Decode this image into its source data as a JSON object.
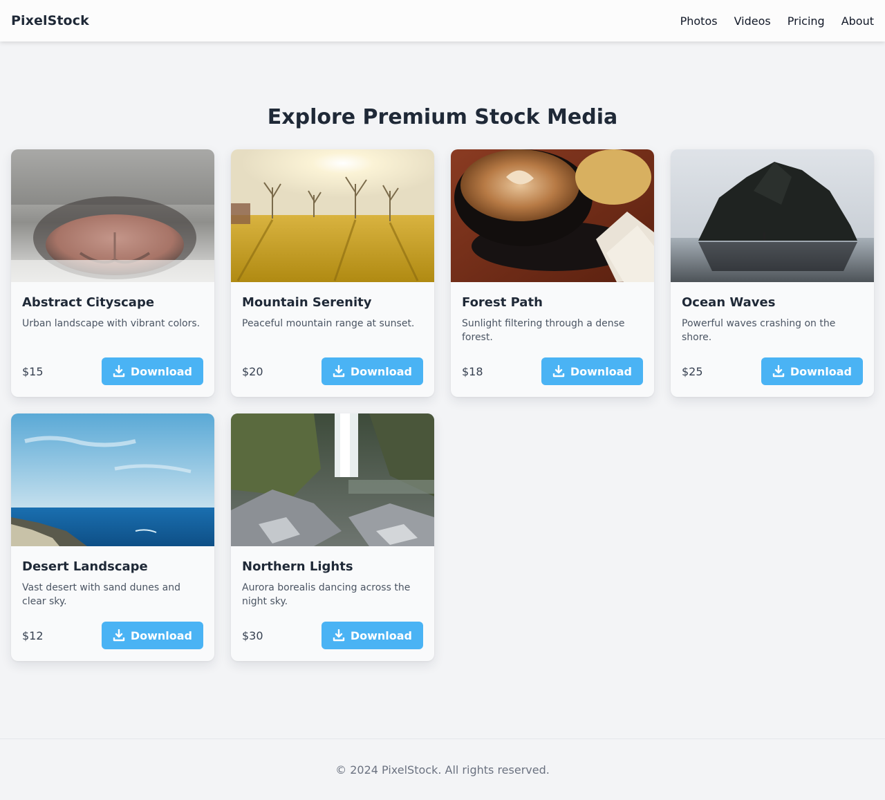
{
  "brand": {
    "name": "PixelStock"
  },
  "nav": {
    "links": [
      "Photos",
      "Videos",
      "Pricing",
      "About"
    ]
  },
  "hero": {
    "title": "Explore Premium Stock Media"
  },
  "colors": {
    "accent": "#4ab3f4",
    "background": "#f3f4f6",
    "heading": "#1f2937"
  },
  "cards": [
    {
      "title": "Abstract Cityscape",
      "desc": "Urban landscape with vibrant colors.",
      "price": "$15",
      "button": "Download",
      "image": "cat-nose-closeup"
    },
    {
      "title": "Mountain Serenity",
      "desc": "Peaceful mountain range at sunset.",
      "price": "$20",
      "button": "Download",
      "image": "sunlit-field-trees"
    },
    {
      "title": "Forest Path",
      "desc": "Sunlight filtering through a dense forest.",
      "price": "$18",
      "button": "Download",
      "image": "coffee-cup-envelopes"
    },
    {
      "title": "Ocean Waves",
      "desc": "Powerful waves crashing on the shore.",
      "price": "$25",
      "button": "Download",
      "image": "sea-rock-beach"
    },
    {
      "title": "Desert Landscape",
      "desc": "Vast desert with sand dunes and clear sky.",
      "price": "$12",
      "button": "Download",
      "image": "blue-sea-coast"
    },
    {
      "title": "Northern Lights",
      "desc": "Aurora borealis dancing across the night sky.",
      "price": "$30",
      "button": "Download",
      "image": "waterfall-rocks"
    }
  ],
  "footer": {
    "text": "© 2024 PixelStock. All rights reserved."
  }
}
